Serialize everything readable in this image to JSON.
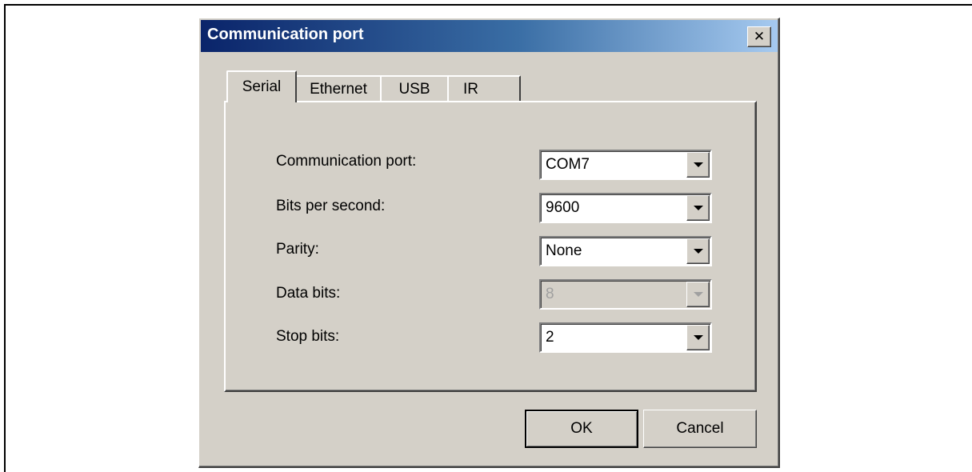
{
  "window": {
    "title": "Communication port",
    "close_glyph": "✕"
  },
  "tabs": [
    {
      "label": "Serial",
      "active": true
    },
    {
      "label": "Ethernet",
      "active": false
    },
    {
      "label": "USB",
      "active": false
    },
    {
      "label": "IR",
      "active": false
    }
  ],
  "fields": [
    {
      "label": "Communication port:",
      "value": "COM7",
      "enabled": true
    },
    {
      "label": "Bits per second:",
      "value": "9600",
      "enabled": true
    },
    {
      "label": "Parity:",
      "value": "None",
      "enabled": true
    },
    {
      "label": "Data bits:",
      "value": "8",
      "enabled": false
    },
    {
      "label": "Stop bits:",
      "value": "2",
      "enabled": true
    }
  ],
  "buttons": {
    "ok": "OK",
    "cancel": "Cancel"
  },
  "icons": {
    "close": "close-icon",
    "dropdown": "chevron-down-icon"
  },
  "colors": {
    "face": "#d4d0c8",
    "title_start": "#0a246a",
    "title_end": "#a6caf0",
    "disabled_text": "#a0a0a0"
  }
}
